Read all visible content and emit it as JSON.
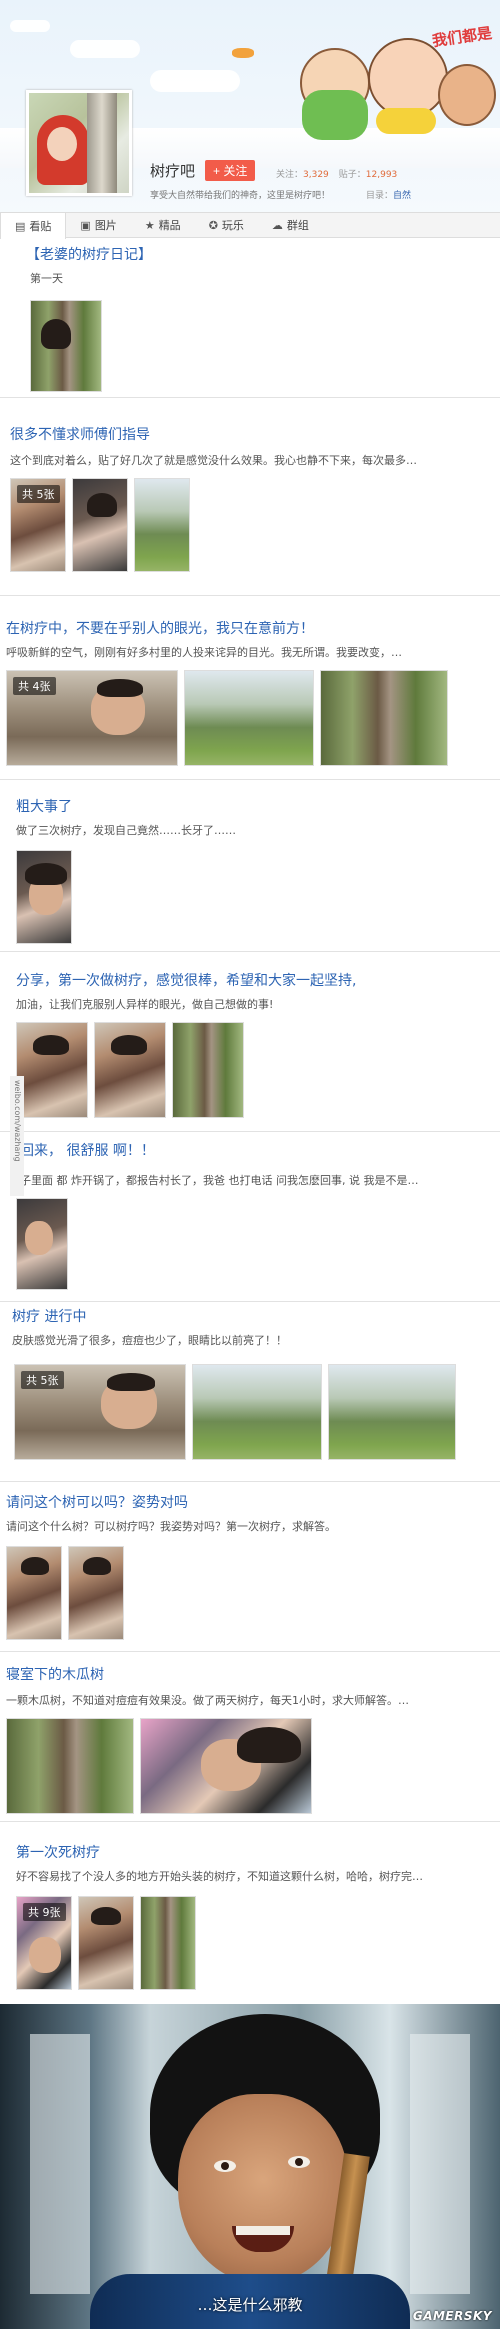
{
  "header": {
    "bar_name": "树疗吧",
    "follow_label": "+ 关注",
    "stats": {
      "follow_label": "关注：",
      "follow_count": "3,329",
      "posts_label": "贴子：",
      "posts_count": "12,993"
    },
    "description": "享受大自然带给我们的神奇，这里是树疗吧！",
    "catalog_label": "目录：",
    "catalog_link": "自然",
    "slogan": "我们都是"
  },
  "tabs": [
    {
      "label": "看贴",
      "icon": "post-icon",
      "active": true
    },
    {
      "label": "图片",
      "icon": "image-icon"
    },
    {
      "label": "精品",
      "icon": "star-icon"
    },
    {
      "label": "玩乐",
      "icon": "game-icon"
    },
    {
      "label": "群组",
      "icon": "group-icon"
    }
  ],
  "posts": [
    {
      "title": "【老婆的树疗日记】",
      "body": "第一天",
      "count": ""
    },
    {
      "title": "很多不懂求师傅们指导",
      "body": "这个到底对着么，贴了好几次了就是感觉没什么效果。我心也静不下来，每次最多…",
      "count": "共 5张"
    },
    {
      "title": "在树疗中，不要在乎别人的眼光，我只在意前方！",
      "body": "呼吸新鲜的空气，刚刚有好多村里的人投来诧异的目光。我无所谓。我要改变，…",
      "count": "共 4张"
    },
    {
      "title": "粗大事了",
      "body": "做了三次树疗，发现自己竟然……长牙了……",
      "count": ""
    },
    {
      "title": "分享，第一次做树疗，感觉很棒，希望和大家一起坚持,",
      "body": "加油，让我们克服别人异样的眼光，做自己想做的事!",
      "count": ""
    },
    {
      "title": "回来， 很舒服 啊！！",
      "body": "子里面 都 炸开锅了，都报告村长了，我爸 也打电话 问我怎麽回事, 说 我是不是…",
      "count": ""
    },
    {
      "title": "树疗 进行中",
      "body": "皮肤感觉光滑了很多，痘痘也少了，眼睛比以前亮了！！",
      "count": "共 5张"
    },
    {
      "title": "请问这个树可以吗？姿势对吗",
      "body": "请问这个什么树？可以树疗吗？我姿势对吗？第一次树疗，求解答。",
      "count": ""
    },
    {
      "title": "寝室下的木瓜树",
      "body": "一颗木瓜树，不知道对痘痘有效果没。做了两天树疗，每天1小时，求大师解答。…",
      "count": ""
    },
    {
      "title": "第一次死树疗",
      "body": "好不容易找了个没人多的地方开始头装的树疗，不知道这颗什么树，哈哈，树疗完…",
      "count": "共 9张"
    }
  ],
  "side_watermark": "weibo.com/wazhang",
  "meme": {
    "subtitle": "…这是什么邪教",
    "watermark": "GAMERSKY"
  }
}
